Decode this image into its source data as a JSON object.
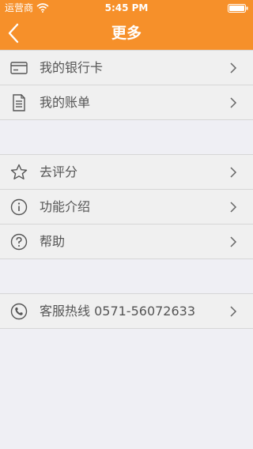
{
  "status_bar": {
    "carrier": "运营商",
    "time": "5:45 PM"
  },
  "nav": {
    "title": "更多"
  },
  "groups": [
    {
      "items": [
        {
          "label": "我的银行卡",
          "icon": "card-icon"
        },
        {
          "label": "我的账单",
          "icon": "bill-icon"
        }
      ]
    },
    {
      "items": [
        {
          "label": "去评分",
          "icon": "star-icon"
        },
        {
          "label": "功能介绍",
          "icon": "info-icon"
        },
        {
          "label": "帮助",
          "icon": "help-icon"
        }
      ]
    },
    {
      "items": [
        {
          "label": "客服热线 0571-56072633",
          "icon": "phone-icon"
        }
      ]
    }
  ],
  "colors": {
    "accent": "#f6902a",
    "background": "#efeff4",
    "text": "#555555",
    "separator": "#d6d6d6"
  }
}
